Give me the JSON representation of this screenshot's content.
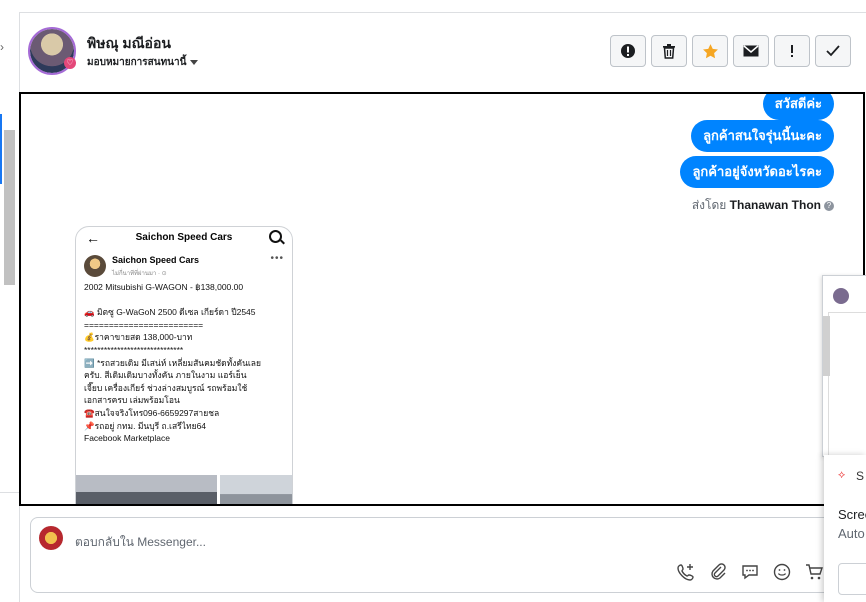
{
  "header": {
    "contact_name": "พิษณุ มณีอ่อน",
    "assign_label": "มอบหมายการสนทนานี้"
  },
  "actions": [
    {
      "name": "spam-button",
      "icon": "alert-circle-icon",
      "color": "#1c1e21"
    },
    {
      "name": "delete-button",
      "icon": "trash-icon",
      "color": "#1c1e21"
    },
    {
      "name": "star-button",
      "icon": "star-icon",
      "color": "#f5a623"
    },
    {
      "name": "mark-unread-button",
      "icon": "envelope-icon",
      "color": "#1c1e21"
    },
    {
      "name": "follow-up-button",
      "icon": "exclamation-icon",
      "color": "#1c1e21"
    },
    {
      "name": "mark-done-button",
      "icon": "check-icon",
      "color": "#1c1e21"
    }
  ],
  "messages": [
    {
      "text": "สวัสดีค่ะ"
    },
    {
      "text": "ลูกค้าสนใจรุ่นนี้นะคะ"
    },
    {
      "text": "ลูกค้าอยู่จังหวัดอะไรคะ"
    }
  ],
  "sent_by": {
    "prefix": "ส่งโดย",
    "agent": "Thanawan Thon"
  },
  "shared_post": {
    "page_title": "Saichon Speed Cars",
    "author": "Saichon Speed Cars",
    "sub": "ไม่กี่นาทีที่ผ่านมา · ⊙",
    "lines": [
      "2002 Mitsubishi G-WAGON - ฿138,000.00",
      "",
      "🚗 มิตซู G-WaGoN 2500 ดีเซล เกียร์ดา ปี2545",
      "========================",
      "💰ราคาขายสด 138,000-บาท",
      "******************************",
      "➡️ *รถสวยเดิม มีเสน่ห์ เหลี่ยมสันคมชัดทั้งคันเลย",
      "ครับ. สีเดิมเดิมบางทั้งคัน ภายในงาม แอร์เย็น",
      "เจี๊ยบ เครื่องเกียร์ ช่วงล่างสมบูรณ์ รถพร้อมใช้",
      "เอกสารครบ เล่มพร้อมโอน",
      "☎️สนใจจริงโทร096-6659297สายชล",
      "📌รถอยู่ กทม. มีนบุรี ถ.เสรีไทย64",
      "Facebook Marketplace"
    ]
  },
  "composer": {
    "placeholder": "ตอบกลับใน Messenger..."
  },
  "composer_tools": [
    "phone-icon",
    "attachment-icon",
    "saved-reply-icon",
    "emoji-icon",
    "cart-icon"
  ],
  "side_panel": {
    "initial": "S",
    "line1": "Scree",
    "line2": "Auto"
  }
}
